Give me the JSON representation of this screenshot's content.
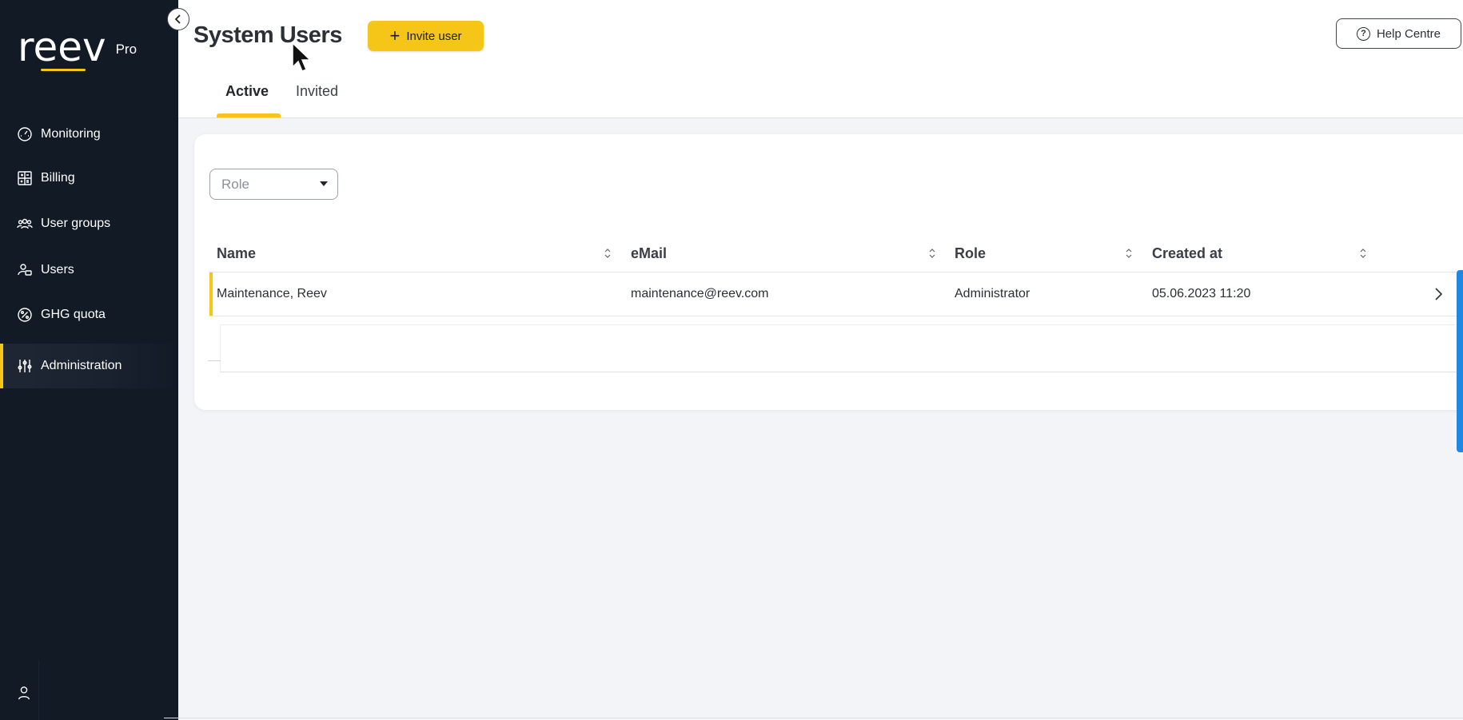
{
  "brand": {
    "name": "reev",
    "tier": "Pro",
    "accent": "#f5c518"
  },
  "sidebar": {
    "items": [
      {
        "label": "Monitoring",
        "icon": "gauge-icon"
      },
      {
        "label": "Billing",
        "icon": "calculator-icon"
      },
      {
        "label": "User groups",
        "icon": "user-group-icon"
      },
      {
        "label": "Users",
        "icon": "user-card-icon"
      },
      {
        "label": "GHG quota",
        "icon": "percent-leaf-icon"
      },
      {
        "label": "Administration",
        "icon": "sliders-icon",
        "active": true
      }
    ]
  },
  "header": {
    "title": "System Users",
    "invite_label": "Invite user",
    "help_label": "Help Centre",
    "tabs": [
      {
        "label": "Active",
        "active": true
      },
      {
        "label": "Invited",
        "active": false
      }
    ]
  },
  "filters": {
    "role_placeholder": "Role"
  },
  "table": {
    "columns": [
      "Name",
      "eMail",
      "Role",
      "Created at"
    ],
    "rows": [
      {
        "name": "Maintenance, Reev",
        "email": "maintenance@reev.com",
        "role": "Administrator",
        "created_at": "05.06.2023 11:20"
      }
    ]
  }
}
